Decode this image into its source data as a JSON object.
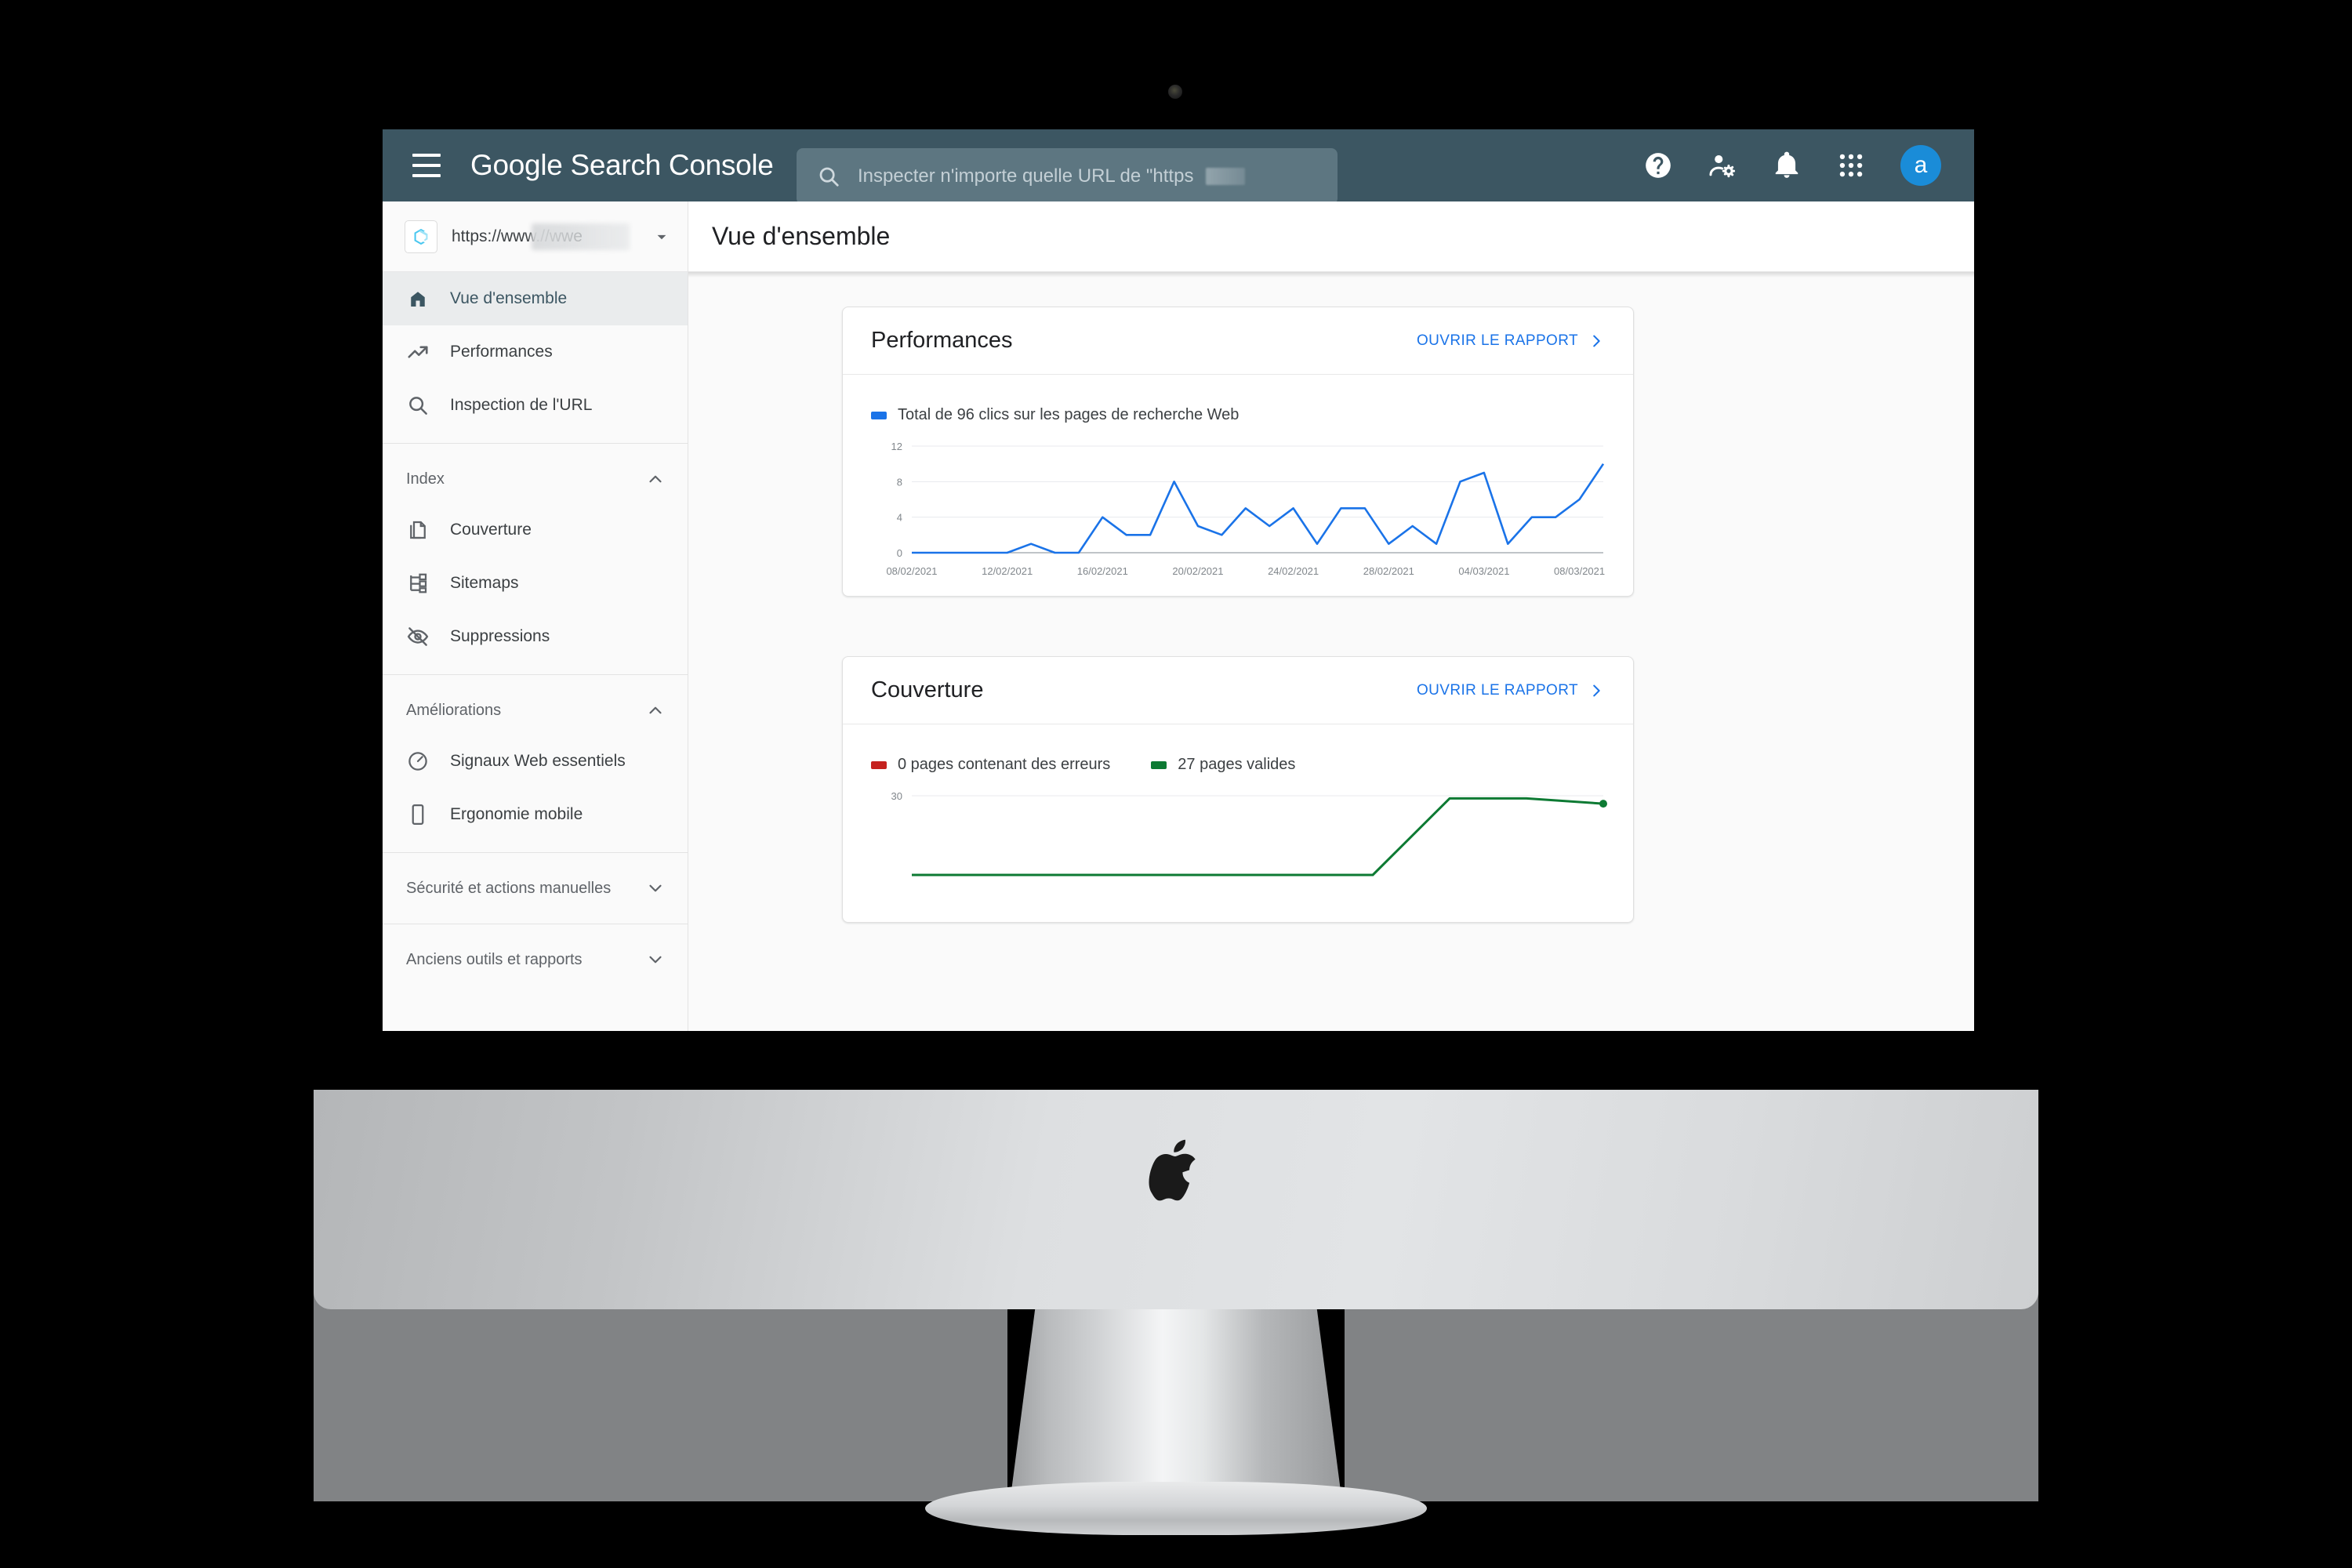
{
  "app": {
    "brand_google": "Google",
    "brand_rest": "Search Console",
    "menu_icon": "hamburger-icon"
  },
  "search": {
    "placeholder": "Inspecter n'importe quelle URL de \"https",
    "icon": "search-icon"
  },
  "topbar_icons": [
    {
      "name": "help-icon",
      "label": "Aide"
    },
    {
      "name": "user-settings-icon",
      "label": "Paramètres utilisateur"
    },
    {
      "name": "notifications-bell-icon",
      "label": "Notifications"
    },
    {
      "name": "apps-grid-icon",
      "label": "Applications Google"
    }
  ],
  "avatar": {
    "initial": "a",
    "color": "#1a8cd8"
  },
  "page": {
    "title": "Vue d'ensemble"
  },
  "property": {
    "url": "https://www.//wwe",
    "favicon": "site-favicon-c",
    "caret": "chevron-down-icon"
  },
  "sidebar": {
    "primary": [
      {
        "label": "Vue d'ensemble",
        "icon": "home-icon",
        "active": true
      },
      {
        "label": "Performances",
        "icon": "trending-up-icon",
        "active": false
      },
      {
        "label": "Inspection de l'URL",
        "icon": "search-icon",
        "active": false
      }
    ],
    "groups": [
      {
        "title": "Index",
        "caret": "chevron-up-icon",
        "items": [
          {
            "label": "Couverture",
            "icon": "pages-copy-icon"
          },
          {
            "label": "Sitemaps",
            "icon": "sitemap-icon"
          },
          {
            "label": "Suppressions",
            "icon": "eye-off-icon"
          }
        ]
      },
      {
        "title": "Améliorations",
        "caret": "chevron-up-icon",
        "items": [
          {
            "label": "Signaux Web essentiels",
            "icon": "speedometer-icon"
          },
          {
            "label": "Ergonomie mobile",
            "icon": "mobile-phone-icon"
          }
        ]
      },
      {
        "title": "Sécurité et actions manuelles",
        "caret": "chevron-down-icon",
        "items": []
      },
      {
        "title": "Anciens outils et rapports",
        "caret": "chevron-down-icon",
        "items": []
      }
    ]
  },
  "cards": {
    "performance": {
      "title": "Performances",
      "link": "OUVRIR LE RAPPORT",
      "link_icon": "chevron-right-icon",
      "legend": [
        {
          "label": "Total de 96 clics sur les pages de recherche Web",
          "color": "#1a73e8"
        }
      ]
    },
    "coverage": {
      "title": "Couverture",
      "link": "OUVRIR LE RAPPORT",
      "link_icon": "chevron-right-icon",
      "legend": [
        {
          "label": "0 pages contenant des erreurs",
          "color": "#c5221f"
        },
        {
          "label": "27 pages valides",
          "color": "#0d7a33"
        }
      ]
    }
  },
  "chart_data": [
    {
      "id": "performance-clicks",
      "type": "line",
      "title": "Total de 96 clics sur les pages de recherche Web",
      "xlabel": "",
      "ylabel": "",
      "ylim": [
        0,
        12
      ],
      "yticks": [
        0,
        4,
        8,
        12
      ],
      "grid": true,
      "legend_position": "top-left",
      "line_color": "#1a73e8",
      "x": [
        "08/02/2021",
        "09/02/2021",
        "10/02/2021",
        "11/02/2021",
        "12/02/2021",
        "13/02/2021",
        "14/02/2021",
        "15/02/2021",
        "16/02/2021",
        "17/02/2021",
        "18/02/2021",
        "19/02/2021",
        "20/02/2021",
        "21/02/2021",
        "22/02/2021",
        "23/02/2021",
        "24/02/2021",
        "25/02/2021",
        "26/02/2021",
        "27/02/2021",
        "28/02/2021",
        "01/03/2021",
        "02/03/2021",
        "03/03/2021",
        "04/03/2021",
        "05/03/2021",
        "06/03/2021",
        "07/03/2021",
        "08/03/2021",
        "09/03/2021"
      ],
      "xtick_labels": [
        "08/02/2021",
        "12/02/2021",
        "16/02/2021",
        "20/02/2021",
        "24/02/2021",
        "28/02/2021",
        "04/03/2021",
        "08/03/2021"
      ],
      "values": [
        0,
        0,
        0,
        0,
        0,
        1,
        0,
        0,
        4,
        2,
        2,
        8,
        3,
        2,
        5,
        3,
        5,
        1,
        5,
        5,
        1,
        3,
        1,
        8,
        9,
        1,
        4,
        4,
        6,
        10
      ],
      "total_clicks": 96
    },
    {
      "id": "coverage-pages",
      "type": "line",
      "title": "Couverture",
      "ylim": [
        0,
        30
      ],
      "yticks": [
        30
      ],
      "grid": true,
      "legend_position": "top-left",
      "series": [
        {
          "name": "0 pages contenant des erreurs",
          "color": "#c5221f",
          "values": [
            0,
            0,
            0,
            0,
            0,
            0,
            0,
            0,
            0,
            0
          ]
        },
        {
          "name": "27 pages valides",
          "color": "#0d7a33",
          "values": [
            0,
            0,
            0,
            0,
            0,
            0,
            0,
            29,
            29,
            27
          ]
        }
      ]
    }
  ]
}
